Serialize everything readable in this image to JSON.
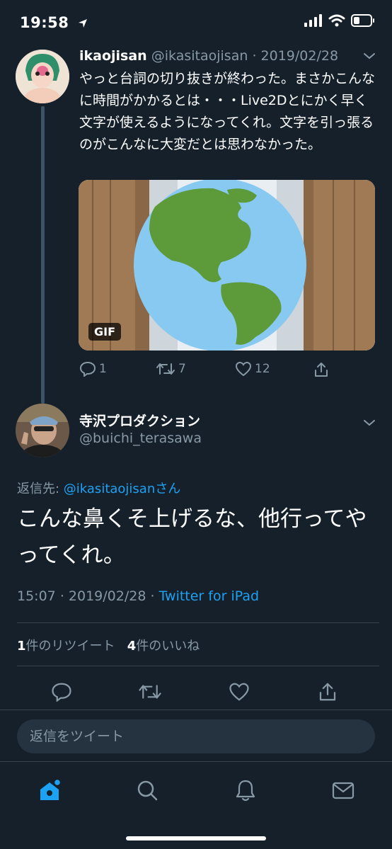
{
  "status": {
    "time": "19:58"
  },
  "tweet1": {
    "name": "ikaojisan",
    "handle": "@ikasitaojisan",
    "date": "2019/02/28",
    "text": "やっと台詞の切り抜きが終わった。まさかこんなに時間がかかるとは・・・Live2Dとにかく早く文字が使えるようになってくれ。文字を引っ張るのがこんなに大変だとは思わなかった。",
    "gif_label": "GIF",
    "replies": "1",
    "retweets": "7",
    "likes": "12"
  },
  "tweet2": {
    "name": "寺沢プロダクション",
    "handle": "@buichi_terasawa",
    "reply_prefix": "返信先: ",
    "reply_handle": "@ikasitaojisan",
    "reply_suffix": "さん",
    "text": "こんな鼻くそ上げるな、他行ってやってくれ。",
    "time": "15:07",
    "date": "2019/02/28",
    "source": "Twitter for iPad",
    "retweet_count": "1",
    "retweet_label": "件のリツイート",
    "like_count": "4",
    "like_label": "件のいいね"
  },
  "reply_box": {
    "placeholder": "返信をツイート"
  },
  "icons": {
    "status": [
      "location-arrow-icon",
      "signal-icon",
      "wifi-icon",
      "battery-icon"
    ],
    "actions": [
      "reply-icon",
      "retweet-icon",
      "like-icon",
      "share-icon"
    ],
    "tabs": [
      "home-icon",
      "search-icon",
      "notifications-icon",
      "messages-icon"
    ]
  },
  "colors": {
    "background": "#15202b",
    "accent": "#1da1f2",
    "muted": "#8899a6",
    "divider": "#38444d"
  }
}
